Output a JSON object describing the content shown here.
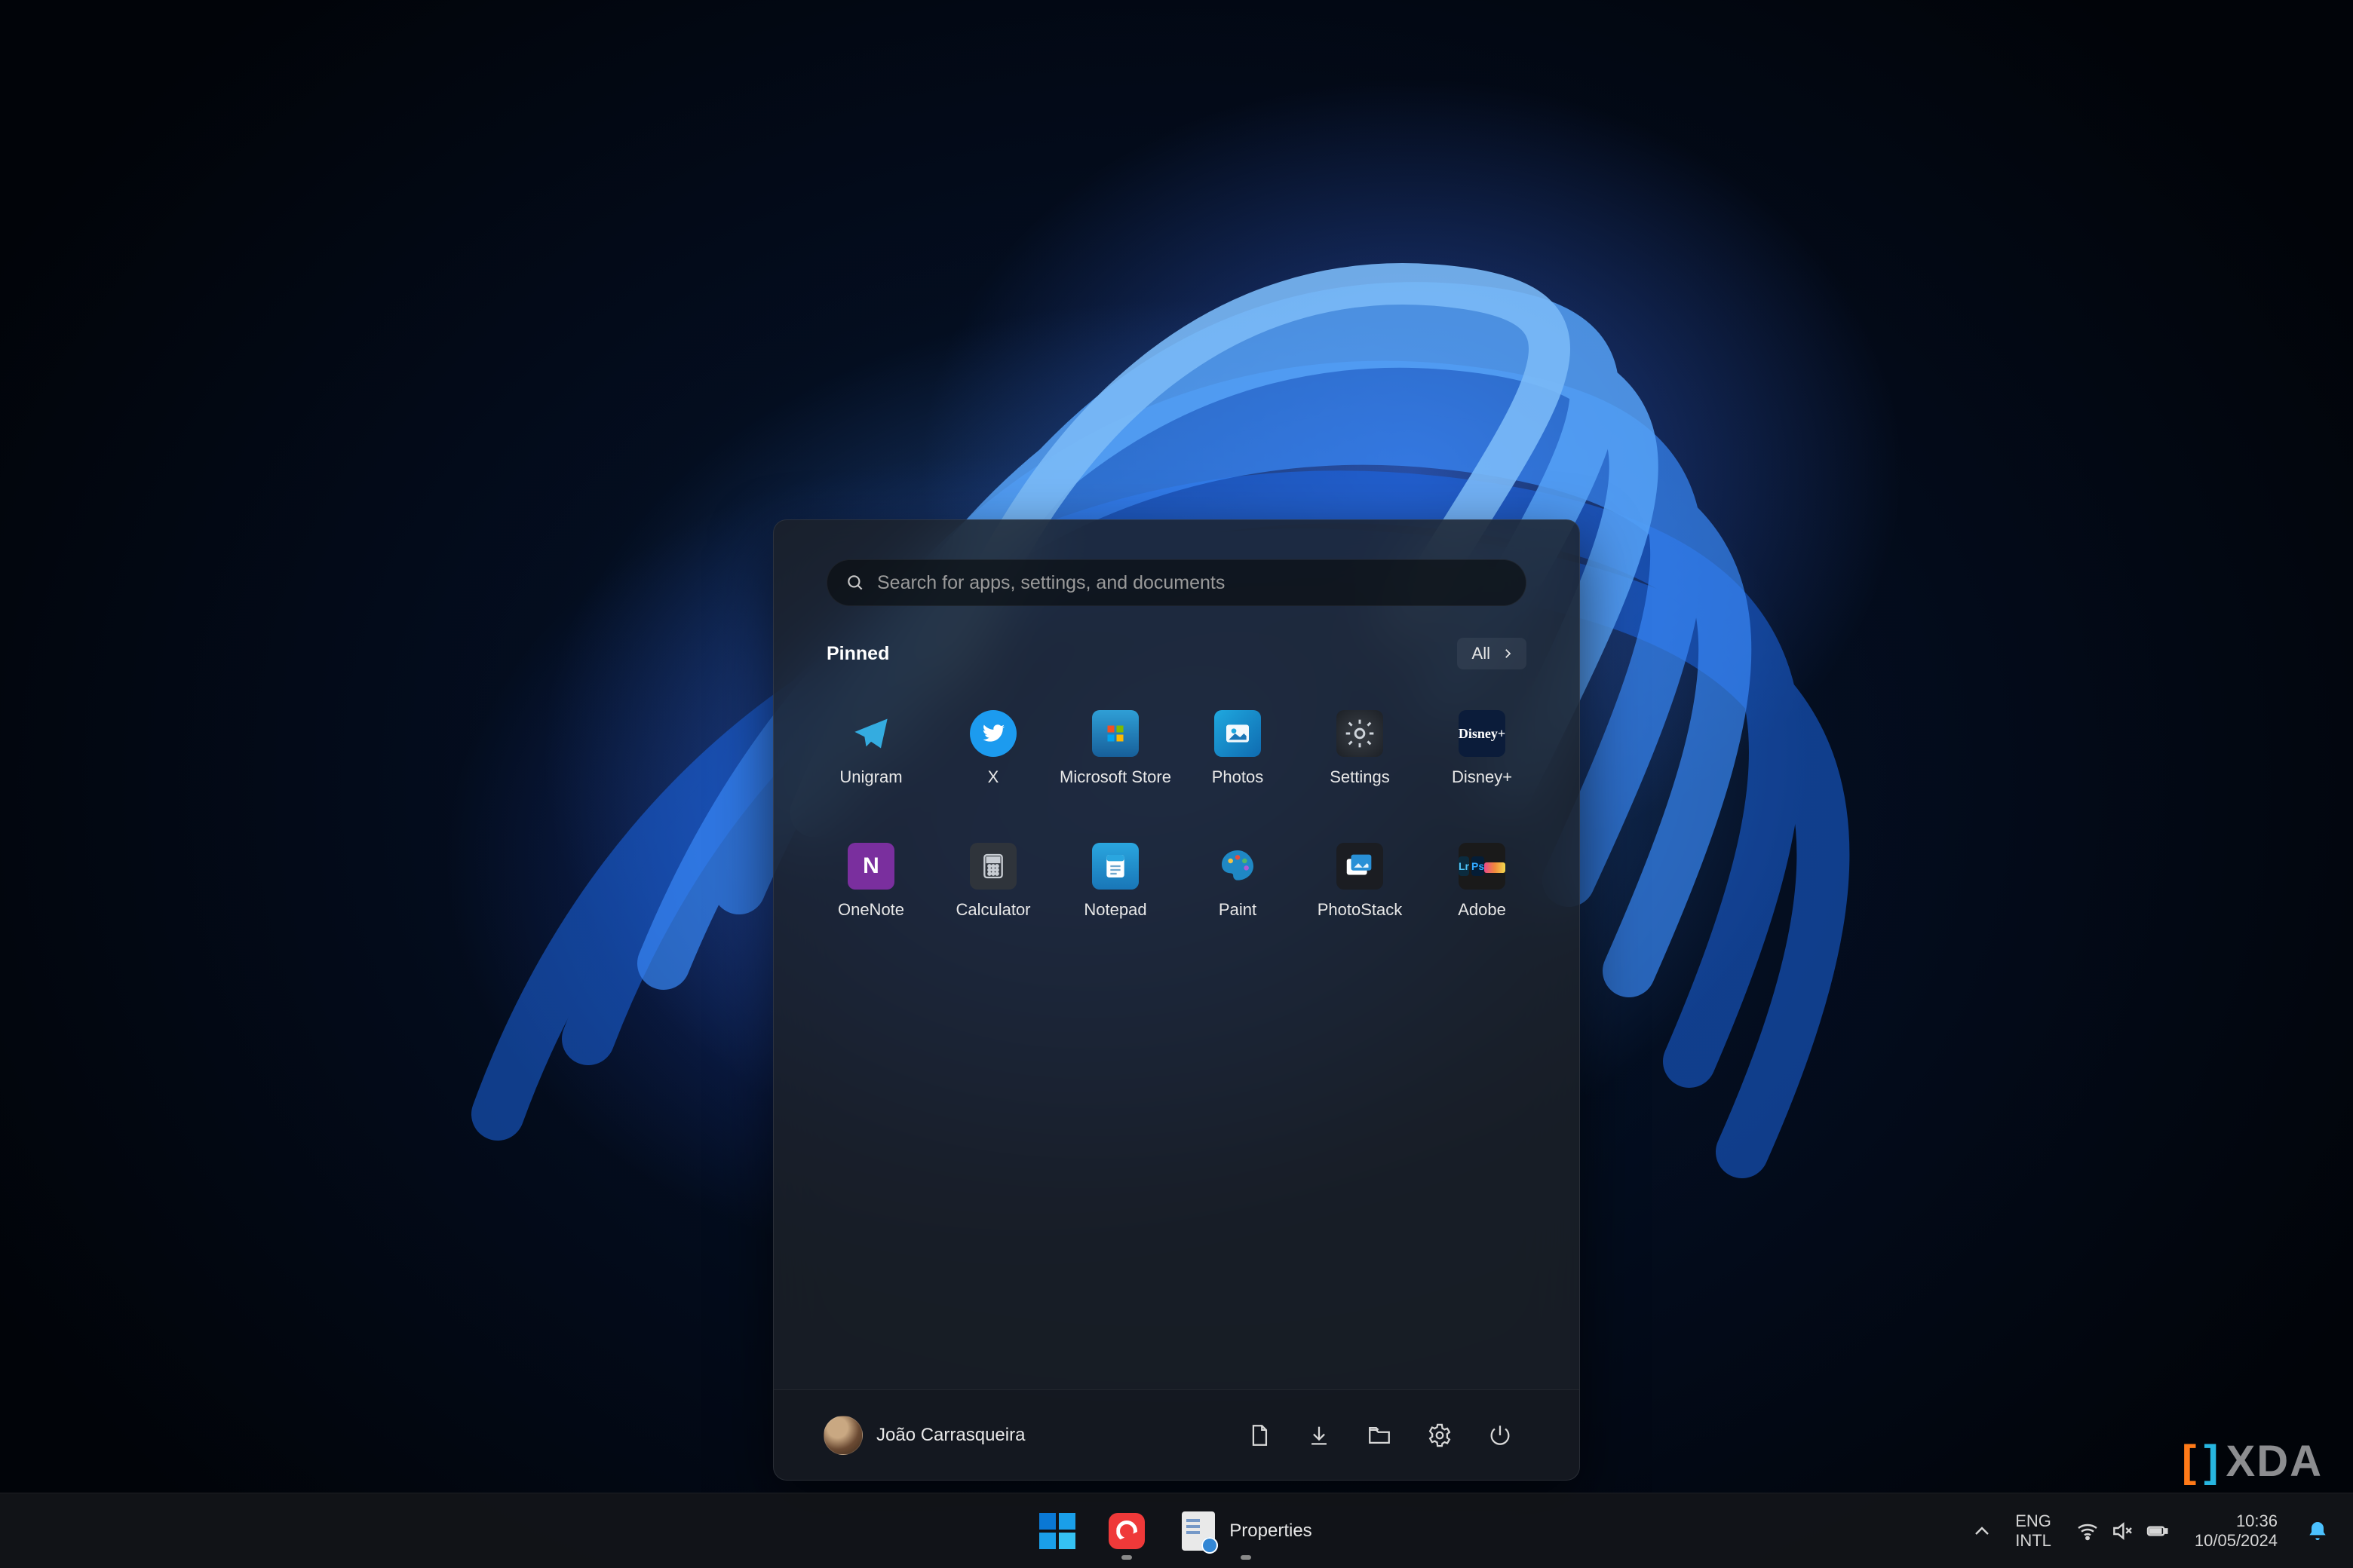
{
  "start_menu": {
    "search": {
      "placeholder": "Search for apps, settings, and documents"
    },
    "pinned_header": {
      "label": "Pinned",
      "all_button": "All"
    },
    "apps": [
      {
        "key": "unigram",
        "label": "Unigram"
      },
      {
        "key": "x",
        "label": "X"
      },
      {
        "key": "store",
        "label": "Microsoft Store"
      },
      {
        "key": "photos",
        "label": "Photos"
      },
      {
        "key": "settings",
        "label": "Settings"
      },
      {
        "key": "disney",
        "label": "Disney+"
      },
      {
        "key": "onenote",
        "label": "OneNote"
      },
      {
        "key": "calculator",
        "label": "Calculator"
      },
      {
        "key": "notepad",
        "label": "Notepad"
      },
      {
        "key": "paint",
        "label": "Paint"
      },
      {
        "key": "photostack",
        "label": "PhotoStack"
      },
      {
        "key": "adobe",
        "label": "Adobe"
      }
    ],
    "user": {
      "name": "João Carrasqueira"
    },
    "footer_icons": [
      {
        "key": "documents",
        "name": "documents-icon"
      },
      {
        "key": "downloads",
        "name": "downloads-icon"
      },
      {
        "key": "explorer",
        "name": "file-explorer-icon"
      },
      {
        "key": "settings",
        "name": "settings-icon"
      },
      {
        "key": "power",
        "name": "power-icon"
      }
    ]
  },
  "taskbar": {
    "items": [
      {
        "key": "start",
        "label": ""
      },
      {
        "key": "vivaldi",
        "label": ""
      },
      {
        "key": "properties",
        "label": "Properties"
      }
    ],
    "tray": {
      "language": {
        "line1": "ENG",
        "line2": "INTL"
      },
      "clock": {
        "time": "10:36",
        "date": "10/05/2024"
      }
    }
  },
  "watermark": {
    "text": "XDA"
  }
}
